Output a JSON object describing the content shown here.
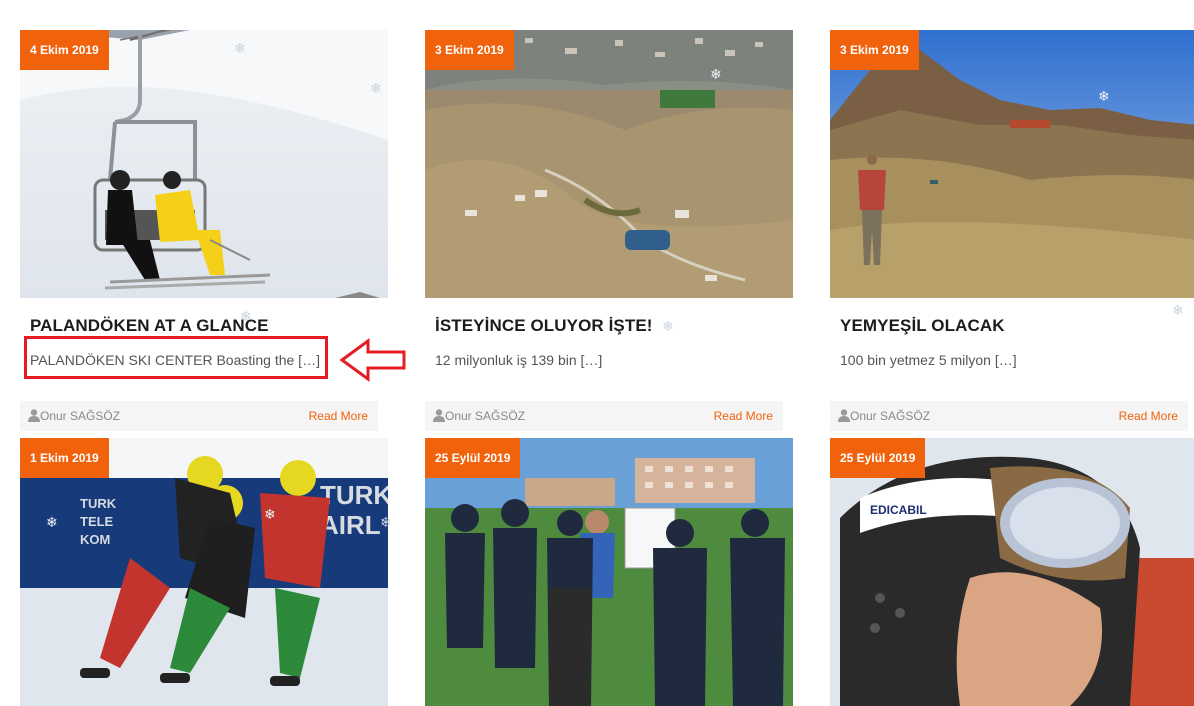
{
  "posts": [
    {
      "date": "4 Ekim 2019",
      "title": "PALANDÖKEN AT A GLANCE",
      "excerpt": "PALANDÖKEN SKI CENTER Boasting the […]",
      "author": "Onur SAĞSÖZ",
      "read_more": "Read More"
    },
    {
      "date": "3 Ekim 2019",
      "title": "İSTEYİNCE OLUYOR İŞTE!",
      "excerpt": "12 milyonluk iş 139 bin […]",
      "author": "Onur SAĞSÖZ",
      "read_more": "Read More"
    },
    {
      "date": "3 Ekim 2019",
      "title": "YEMYEŞİL OLACAK",
      "excerpt": "100 bin yetmez 5 milyon […]",
      "author": "Onur SAĞSÖZ",
      "read_more": "Read More"
    },
    {
      "date": "1 Ekim 2019"
    },
    {
      "date": "25 Eylül 2019"
    },
    {
      "date": "25 Eylül 2019"
    }
  ],
  "photo_signage": {
    "ticket_turk": "TURK",
    "ticket_tele": "TELE",
    "ticket_kom": "KOM",
    "ticket_turkish": "TURK",
    "ticket_airlines": "AIRL",
    "helmet_brand": "EDICABIL"
  },
  "colors": {
    "accent": "#f1620c",
    "highlight": "#e51c23"
  }
}
